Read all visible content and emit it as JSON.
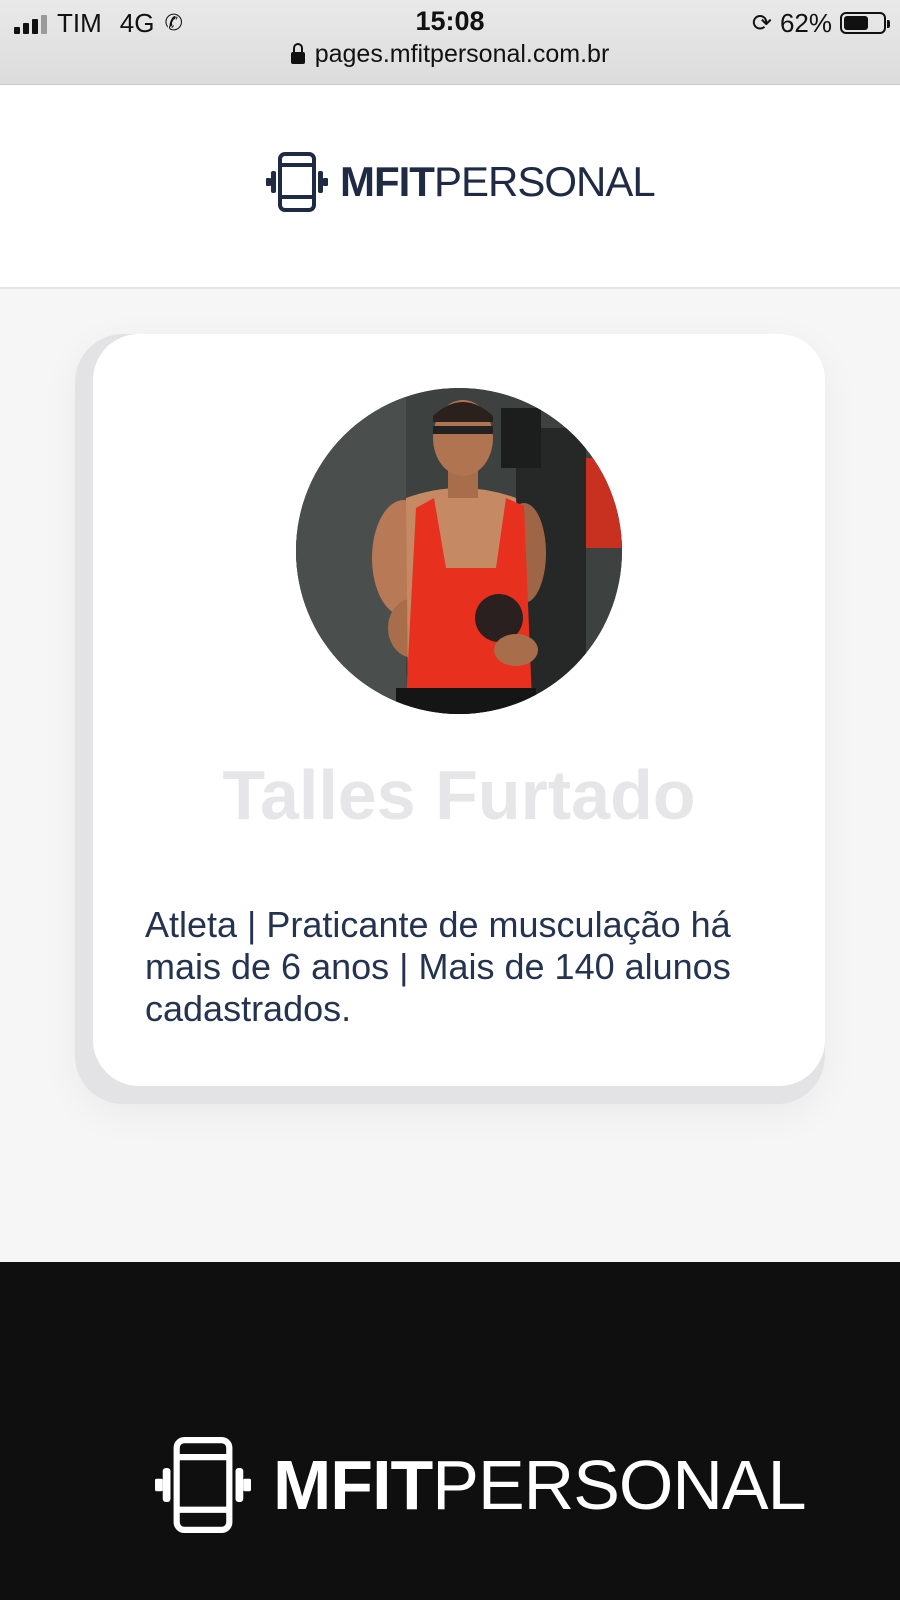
{
  "status_bar": {
    "carrier": "TIM",
    "network": "4G",
    "time": "15:08",
    "battery_percent": "62%",
    "battery_level": 0.62,
    "url": "pages.mfitpersonal.com.br"
  },
  "header": {
    "logo_bold": "MFIT",
    "logo_light": "PERSONAL"
  },
  "profile": {
    "name": "Talles Furtado",
    "bio": "Atleta | Praticante de musculação há mais de 6 anos | Mais de 140 alunos cadastrados."
  },
  "footer": {
    "logo_bold": "MFIT",
    "logo_light": "PERSONAL"
  },
  "colors": {
    "brand_dark": "#1f2a44",
    "footer_bg": "#0f0f10",
    "tank_top": "#e8301f"
  }
}
